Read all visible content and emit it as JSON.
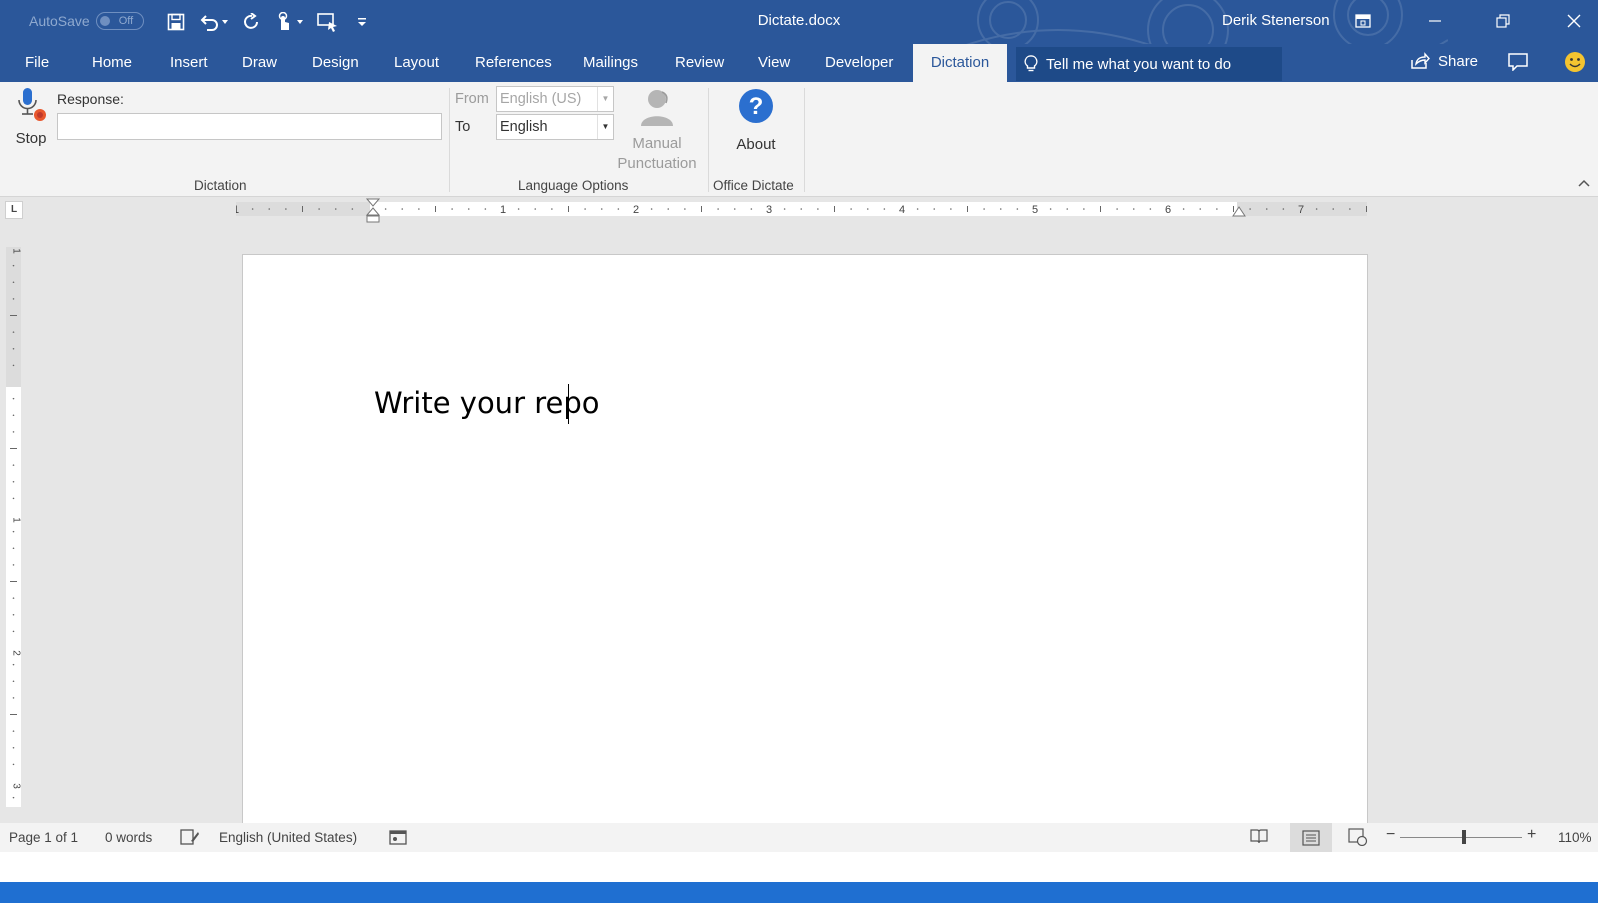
{
  "window": {
    "autosave_label": "AutoSave",
    "autosave_state": "Off",
    "title": "Dictate.docx",
    "user": "Derik Stenerson"
  },
  "tabs": [
    {
      "label": "File"
    },
    {
      "label": "Home"
    },
    {
      "label": "Insert"
    },
    {
      "label": "Draw"
    },
    {
      "label": "Design"
    },
    {
      "label": "Layout"
    },
    {
      "label": "References"
    },
    {
      "label": "Mailings"
    },
    {
      "label": "Review"
    },
    {
      "label": "View"
    },
    {
      "label": "Developer"
    },
    {
      "label": "Dictation"
    }
  ],
  "active_tab": "Dictation",
  "tell_me": "Tell me what you want to do",
  "share_label": "Share",
  "ribbon": {
    "stop_label": "Stop",
    "response_label": "Response:",
    "response_value": "",
    "dictation_group": "Dictation",
    "from_label": "From",
    "from_value": "English (US)",
    "to_label": "To",
    "to_value": "English",
    "manual_label": "Manual",
    "punctuation_label": "Punctuation",
    "language_group": "Language Options",
    "about_label": "About",
    "office_group": "Office Dictate"
  },
  "ruler": {
    "h_numbers": [
      "1",
      "1",
      "2",
      "3",
      "4",
      "5",
      "6",
      "7"
    ],
    "v_numbers": [
      "1",
      "1",
      "2",
      "3"
    ]
  },
  "document": {
    "text": "Write your repo"
  },
  "status": {
    "page": "Page 1 of 1",
    "words": "0 words",
    "language": "English (United States)",
    "zoom": "110%"
  },
  "colors": {
    "title_bar": "#2b579a",
    "ribbon": "#f3f3f3",
    "canvas": "#e6e6e6",
    "taskbar": "#1f6fd1"
  }
}
